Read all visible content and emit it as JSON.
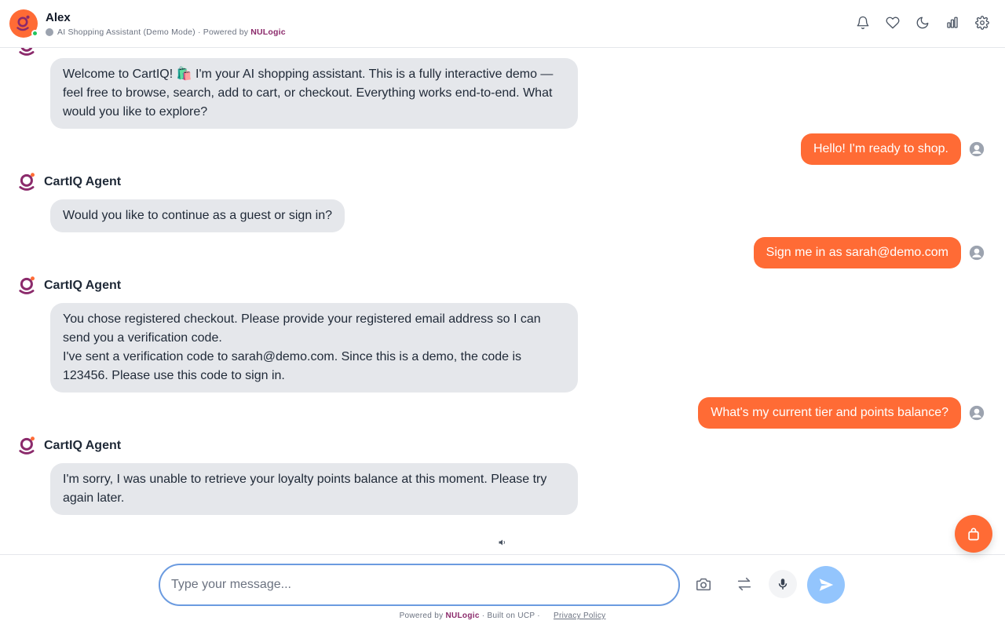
{
  "header": {
    "name": "Alex",
    "subtitle_prefix": "AI Shopping Assistant (Demo Mode) · Powered by",
    "brand": "NULogic",
    "colors": {
      "accent": "#ff6b35",
      "brand": "#8b2a6b",
      "online": "#22c55e"
    },
    "icons": [
      "bell-icon",
      "heart-icon",
      "moon-icon",
      "bar-chart-icon",
      "gear-icon"
    ]
  },
  "chat": {
    "agent_name": "CartIQ Agent",
    "messages": [
      {
        "role": "agent",
        "text": "Welcome to CartIQ! 🛍️ I'm your AI shopping assistant. This is a fully interactive demo — feel free to browse, search, add to cart, or checkout. Everything works end-to-end. What would you like to explore?"
      },
      {
        "role": "user",
        "text": "Hello! I'm ready to shop."
      },
      {
        "role": "agent",
        "text": "Would you like to continue as a guest or sign in?"
      },
      {
        "role": "user",
        "text": "Sign me in as sarah@demo.com"
      },
      {
        "role": "agent",
        "text": "You chose registered checkout. Please provide your registered email address so I can send you a verification code.\nI've sent a verification code to sarah@demo.com. Since this is a demo, the code is 123456. Please use this code to sign in."
      },
      {
        "role": "user",
        "text": "What's my current tier and points balance?"
      },
      {
        "role": "agent",
        "text": "I'm sorry, I was unable to retrieve your loyalty points balance at this moment. Please try again later."
      }
    ]
  },
  "composer": {
    "placeholder": "Type your message...",
    "icons": [
      "camera-icon",
      "swap-icon",
      "microphone-icon",
      "send-icon"
    ]
  },
  "footer": {
    "powered_prefix": "Powered by",
    "brand": "NULogic",
    "built_on": "· Built on UCP ·",
    "privacy": "Privacy Policy"
  }
}
